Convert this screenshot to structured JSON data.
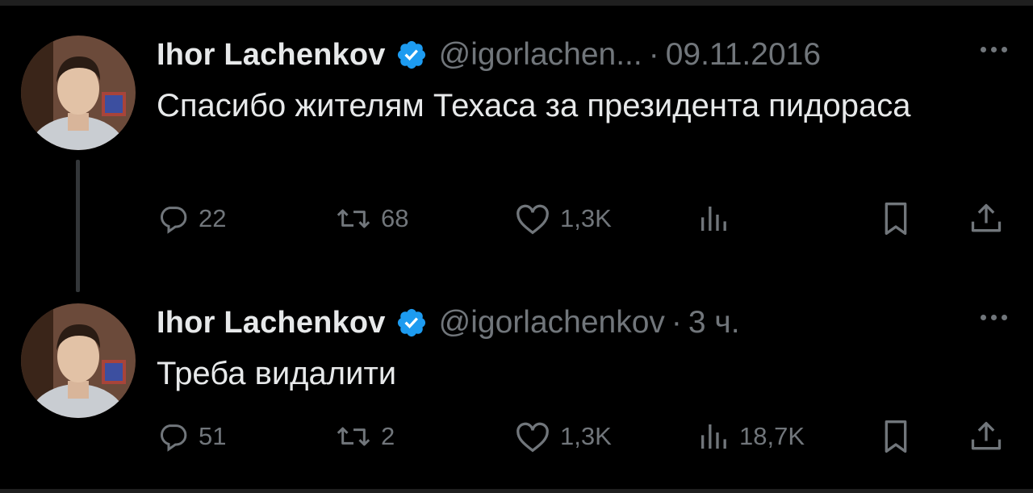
{
  "tweets": [
    {
      "author_name": "Ihor Lachenkov",
      "handle": "@igorlachen...",
      "separator": "·",
      "time": "09.11.2016",
      "text": "Спасибо жителям Техаса за президента пидораса",
      "replies": "22",
      "retweets": "68",
      "likes": "1,3K",
      "views": ""
    },
    {
      "author_name": "Ihor Lachenkov",
      "handle": "@igorlachenkov",
      "separator": "·",
      "time": "3 ч.",
      "text": "Треба видалити",
      "replies": "51",
      "retweets": "2",
      "likes": "1,3K",
      "views": "18,7K"
    }
  ],
  "colors": {
    "background": "#000000",
    "primary_text": "#e7e9ea",
    "secondary_text": "#71767b",
    "verified_badge": "#1d9bf0",
    "thread_line": "#333639"
  },
  "icons": [
    "verified-badge-icon",
    "more-icon",
    "reply-icon",
    "retweet-icon",
    "like-icon",
    "views-icon",
    "bookmark-icon",
    "share-icon"
  ]
}
